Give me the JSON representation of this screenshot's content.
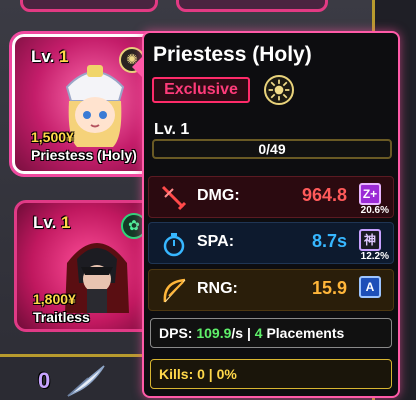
{
  "colors": {
    "accent": "#ff5aa8",
    "exclusive": "#ff3b7a",
    "gold": "#ffd84a",
    "dmg_value": "#ff5a5a",
    "spa_value": "#37b7ff",
    "rng_value": "#ffb63a",
    "dps_green": "#5ff06a"
  },
  "units": [
    {
      "lv_label": "Lv.",
      "lv_num": "1",
      "cost": "1,500¥",
      "name": "Priestess (Holy)",
      "element_icon": "holy-sun-icon"
    },
    {
      "lv_label": "Lv.",
      "lv_num": "1",
      "cost": "1,800¥",
      "name": "Traitless",
      "element_icon": "wind-swirl-icon"
    }
  ],
  "bottom": {
    "gem_count": "0",
    "icon": "feather-quill-icon"
  },
  "tooltip": {
    "title": "Priestess (Holy)",
    "rarity": "Exclusive",
    "element_icon": "holy-sun-icon",
    "level": "Lv. 1",
    "xp_text": "0/49",
    "xp_fraction": 0,
    "stats": [
      {
        "label": "DMG:",
        "value": "964.8",
        "grade": "Z+",
        "grade_pct": "20.6%",
        "icon": "sword-icon"
      },
      {
        "label": "SPA:",
        "value": "8.7s",
        "grade": "神",
        "grade_pct": "12.2%",
        "icon": "stopwatch-icon"
      },
      {
        "label": "RNG:",
        "value": "15.9",
        "grade": "A",
        "grade_pct": "",
        "icon": "bow-icon"
      }
    ],
    "dps_label": "DPS:",
    "dps_value": "109.9",
    "dps_unit": "/s |",
    "placements_num": "4",
    "placements_label": "Placements",
    "kills_text": "Kills: 0 | 0%"
  }
}
